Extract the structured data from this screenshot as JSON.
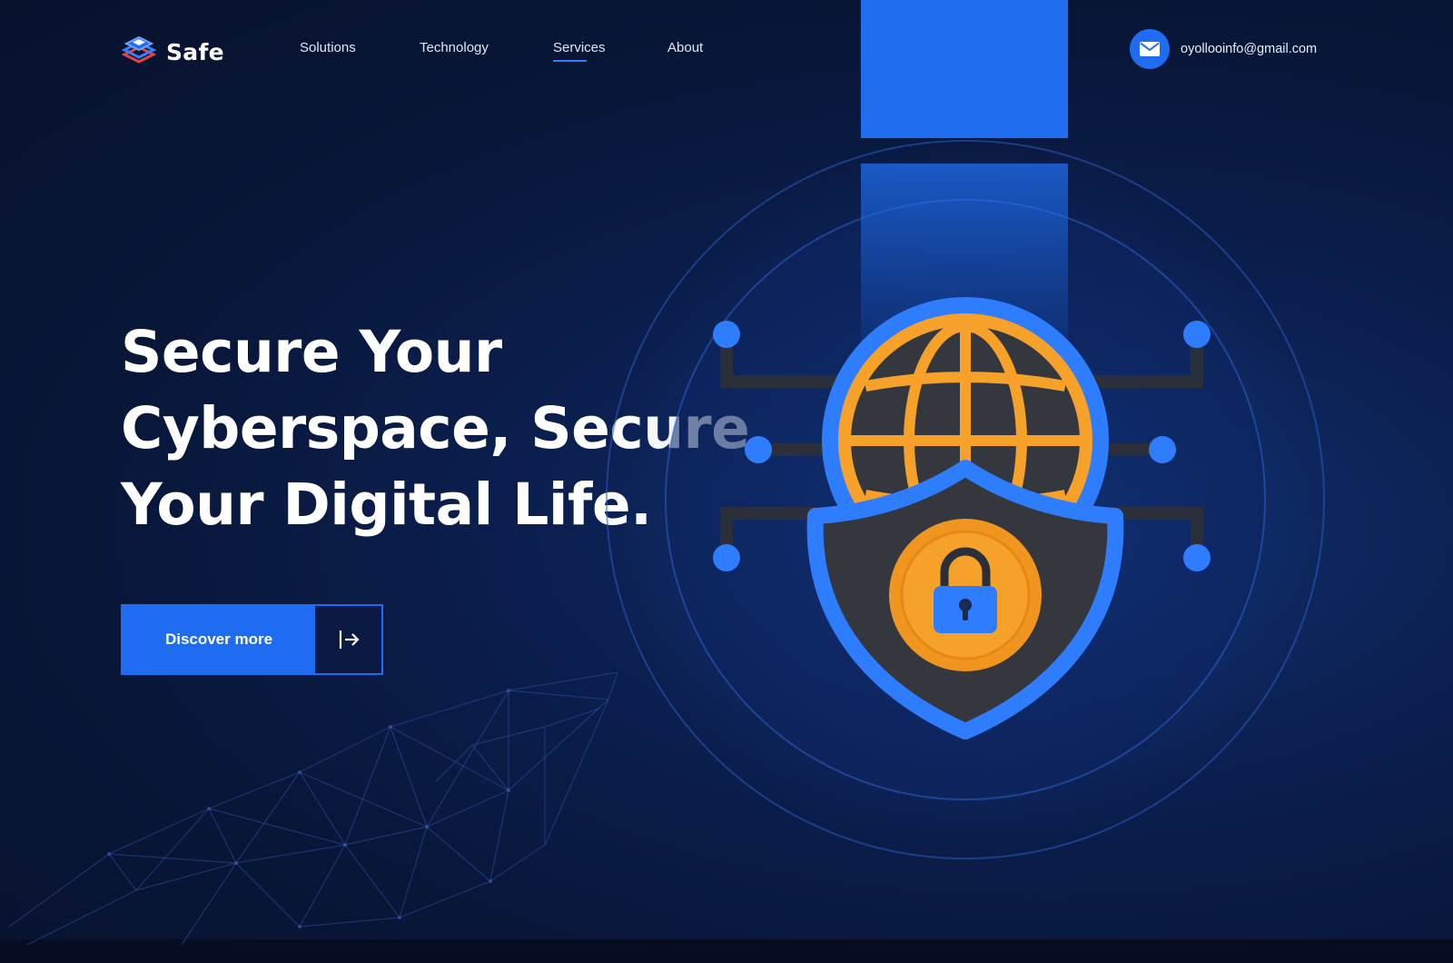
{
  "brand": {
    "name": "Safe",
    "logo_icon": "stacked-layers-icon"
  },
  "nav": {
    "items": [
      {
        "label": "Solutions",
        "active": false
      },
      {
        "label": "Technology",
        "active": false
      },
      {
        "label": "Services",
        "active": true
      },
      {
        "label": "About",
        "active": false
      }
    ]
  },
  "contact": {
    "icon": "mail-icon",
    "email": "oyollooinfo@gmail.com"
  },
  "hero": {
    "title_lines": [
      "Secure Your",
      "Cyberspace, Secure",
      "Your Digital Life."
    ],
    "cta_label": "Discover more",
    "cta_icon": "arrow-right-from-bar-icon"
  },
  "illustration": {
    "icon": "globe-shield-lock-icon",
    "decor": "wireframe-hand"
  },
  "colors": {
    "accent_blue": "#1d6cf2",
    "accent_orange": "#f5a12a",
    "background": "#081638"
  }
}
